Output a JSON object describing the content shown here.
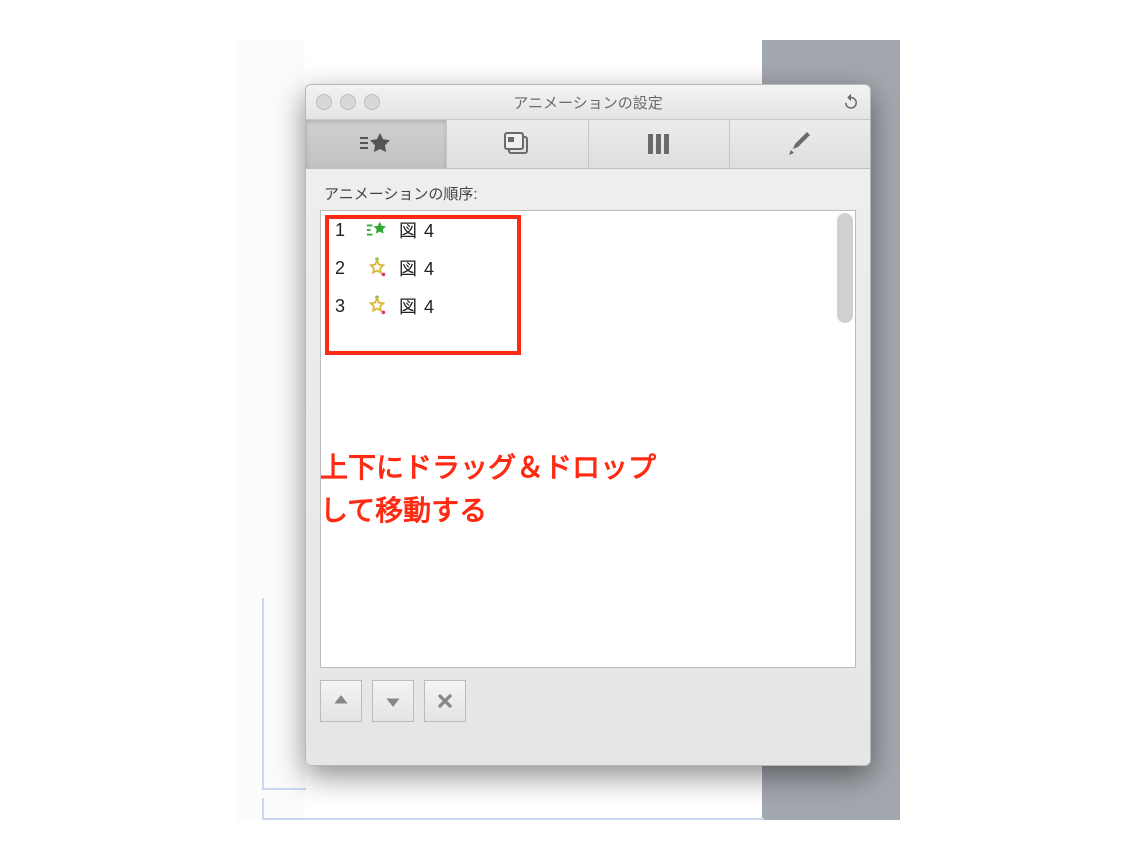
{
  "window": {
    "title": "アニメーションの設定"
  },
  "section_label": "アニメーションの順序:",
  "items": [
    {
      "index": "1",
      "label": "図 4",
      "kind": "entrance"
    },
    {
      "index": "2",
      "label": "図 4",
      "kind": "emphasis"
    },
    {
      "index": "3",
      "label": "図 4",
      "kind": "emphasis"
    }
  ],
  "annotation": {
    "line1": "上下にドラッグ＆ドロップ",
    "line2": "して移動する"
  }
}
